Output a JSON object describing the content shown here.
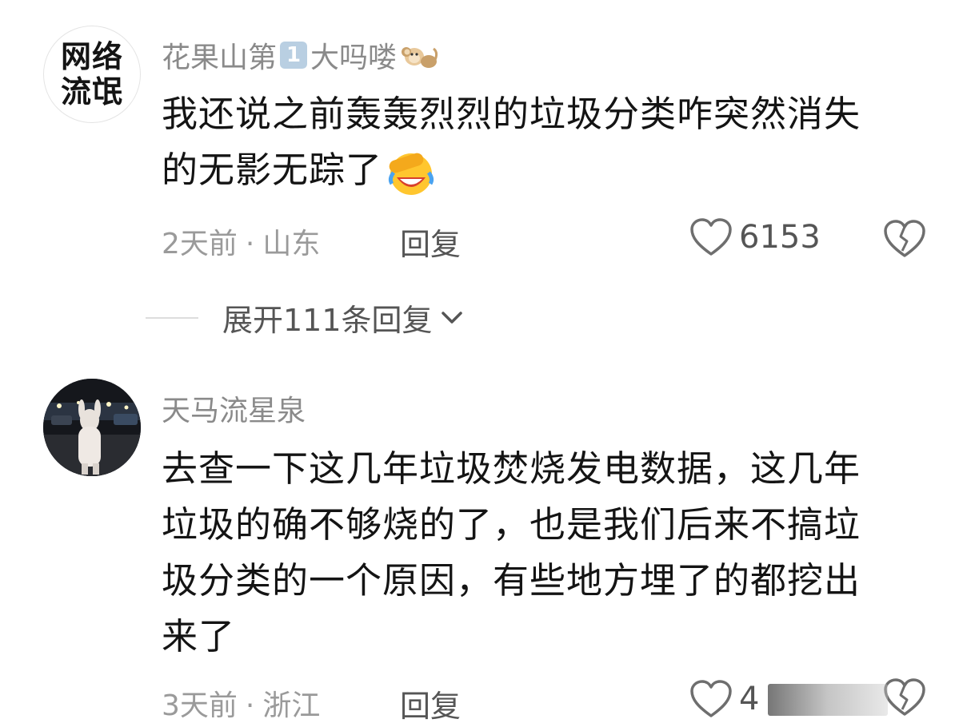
{
  "comments": [
    {
      "avatar_text": [
        "网络",
        "流氓"
      ],
      "username": "花果山第",
      "level": "1",
      "username_tail": "大吗喽",
      "text_line1": "我还说之前轰轰烈烈的垃圾分类咋突然消失",
      "text_line2": "的无影无踪了",
      "time": "2天前",
      "location": "山东",
      "reply_label": "回复",
      "like_count": "6153"
    },
    {
      "username": "天马流星泉",
      "text_lines": [
        "去查一下这几年垃圾焚烧发电数据，这几年",
        "垃圾的确不够烧的了，也是我们后来不搞垃",
        "圾分类的一个原因，有些地方埋了的都挖出",
        "来了"
      ],
      "time": "3天前",
      "location": "浙江",
      "reply_label": "回复",
      "like_count": "4"
    }
  ],
  "expand": {
    "label": "展开111条回复"
  },
  "separator": "·",
  "colors": {
    "text_primary": "#141414",
    "text_secondary": "#8a8a8a",
    "badge": "#b9cfe2"
  }
}
